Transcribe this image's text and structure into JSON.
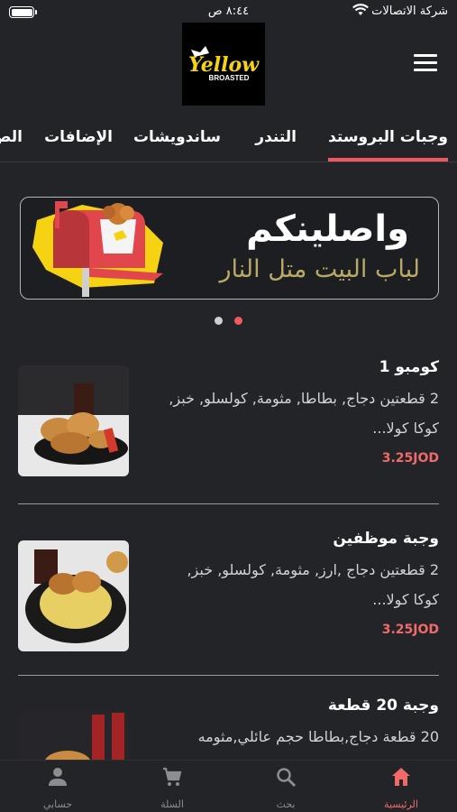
{
  "status_bar": {
    "carrier": "شركة الاتصالات",
    "time": "٨:٤٤ ص"
  },
  "brand": {
    "logo_text_main": "Yellow",
    "logo_text_sub": "BROASTED",
    "accent_color": "#f05a5f",
    "logo_color": "#f5d312"
  },
  "tabs": [
    {
      "label": "وجبات البروستد",
      "active": true
    },
    {
      "label": "التندر",
      "active": false
    },
    {
      "label": "ساندويشات",
      "active": false
    },
    {
      "label": "الإضافات",
      "active": false
    },
    {
      "label": "الص",
      "active": false
    }
  ],
  "banner": {
    "title": "واصلينكم",
    "subtitle": "لباب البيت متل النار",
    "active_slide": 1,
    "slide_count": 2
  },
  "products": [
    {
      "name": "كومبو 1",
      "description": "2 قطعتين دجاج, بطاطا, مثومة, كولسلو, خبز, كوكا كولا...",
      "price": "3.25JOD"
    },
    {
      "name": "وجبة موظفين",
      "description": "2 قطعتين دجاج ,ارز, مثومة, كولسلو, خبز, كوكا كولا...",
      "price": "3.25JOD"
    },
    {
      "name": "وجبة 20 قطعة",
      "description": "20 قطعة دجاج,بطاطا حجم عائلي,مثومه",
      "price": ""
    }
  ],
  "bottom_nav": [
    {
      "label": "الرئيسية",
      "icon": "home-icon",
      "active": true
    },
    {
      "label": "بحث",
      "icon": "search-icon",
      "active": false
    },
    {
      "label": "السلة",
      "icon": "cart-icon",
      "active": false
    },
    {
      "label": "حسابي",
      "icon": "account-icon",
      "active": false
    }
  ]
}
